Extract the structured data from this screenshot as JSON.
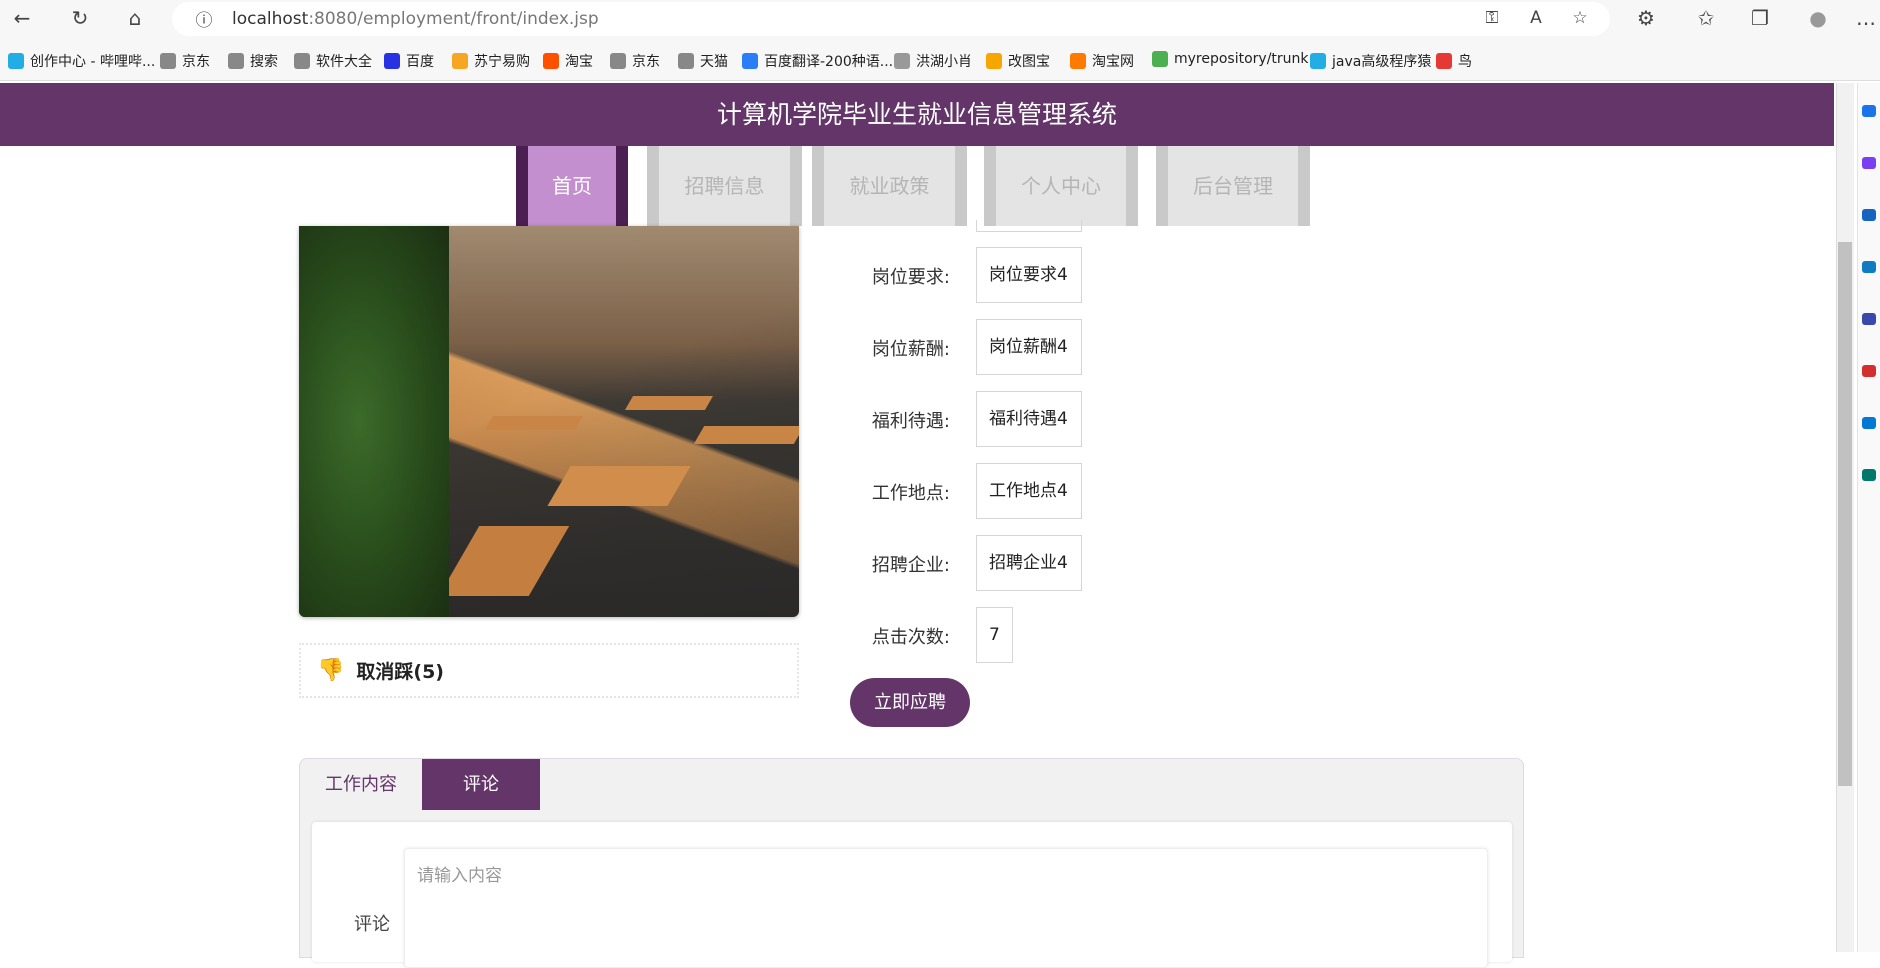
{
  "browser": {
    "url_host": "localhost",
    "url_path": ":8080/employment/front/index.jsp",
    "bookmarks": [
      {
        "label": "创作中心 - 哔哩哔...",
        "color": "#23ade5"
      },
      {
        "label": "京东",
        "color": "#888"
      },
      {
        "label": "搜索",
        "color": "#888"
      },
      {
        "label": "软件大全",
        "color": "#888"
      },
      {
        "label": "百度",
        "color": "#2932e1"
      },
      {
        "label": "苏宁易购",
        "color": "#f5a623"
      },
      {
        "label": "淘宝",
        "color": "#ff5000"
      },
      {
        "label": "京东",
        "color": "#888"
      },
      {
        "label": "天猫",
        "color": "#888"
      },
      {
        "label": "百度翻译-200种语...",
        "color": "#2a7ef7"
      },
      {
        "label": "洪湖小肖",
        "color": "#999"
      },
      {
        "label": "改图宝",
        "color": "#f7a600"
      },
      {
        "label": "淘宝网",
        "color": "#ff7a00"
      },
      {
        "label": "myrepository/trunk...",
        "color": "#4caf50"
      },
      {
        "label": "java高级程序猿",
        "color": "#23ade5"
      },
      {
        "label": "鸟",
        "color": "#e53935"
      }
    ]
  },
  "header": {
    "title": "计算机学院毕业生就业信息管理系统"
  },
  "nav": [
    {
      "label": "首页"
    },
    {
      "label": "招聘信息"
    },
    {
      "label": "就业政策"
    },
    {
      "label": "个人中心"
    },
    {
      "label": "后台管理"
    }
  ],
  "dislike": {
    "label": "取消踩(5)"
  },
  "fields": [
    {
      "label": "岗位要求:",
      "value": "岗位要求4"
    },
    {
      "label": "岗位薪酬:",
      "value": "岗位薪酬4"
    },
    {
      "label": "福利待遇:",
      "value": "福利待遇4"
    },
    {
      "label": "工作地点:",
      "value": "工作地点4"
    },
    {
      "label": "招聘企业:",
      "value": "招聘企业4"
    },
    {
      "label": "点击次数:",
      "value": "7"
    }
  ],
  "apply_label": "立即应聘",
  "tabs": [
    {
      "label": "工作内容"
    },
    {
      "label": "评论"
    }
  ],
  "comment": {
    "label": "评论",
    "placeholder": "请输入内容"
  },
  "colors": {
    "brand": "#633569",
    "nav_active": "#c38fcf"
  }
}
